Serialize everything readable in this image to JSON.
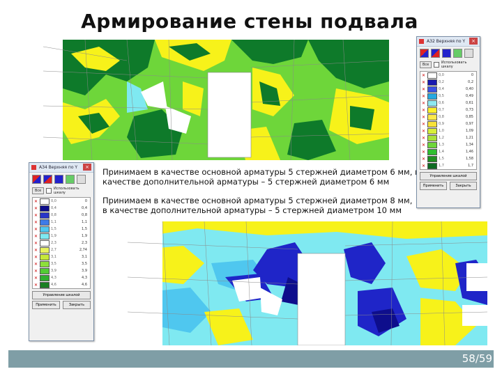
{
  "slide": {
    "title": "Армирование стены подвала",
    "page_current": "58",
    "page_total": "59"
  },
  "captions": {
    "top": "Принимаем в качестве основной арматуры 5 стержней диаметром 6 мм, в качестве дополнительной арматуры – 5 стержней диаметром 6 мм",
    "bottom": "Принимаем в качестве основной арматуры 5 стержней диаметром 8 мм, в качестве дополнительной арматуры – 5 стержней диаметром 10 мм"
  },
  "dialog_right": {
    "title": "АЗ2 Верхняя по Y",
    "button_all": "Все",
    "option_label": "Использовать шкалу",
    "legend": [
      {
        "name": "0,0",
        "color": "#ffffff",
        "value": "0"
      },
      {
        "name": "0,2",
        "color": "#1a1ab0",
        "value": "0,2"
      },
      {
        "name": "0,4",
        "color": "#3c52e6",
        "value": "0,40"
      },
      {
        "name": "0,5",
        "color": "#27a9e1",
        "value": "0,49"
      },
      {
        "name": "0,6",
        "color": "#8ee8f0",
        "value": "0,61"
      },
      {
        "name": "0,7",
        "color": "#fff12a",
        "value": "0,73"
      },
      {
        "name": "0,8",
        "color": "#fde94a",
        "value": "0,85"
      },
      {
        "name": "0,9",
        "color": "#f7e23a",
        "value": "0,97"
      },
      {
        "name": "1,0",
        "color": "#d7ef3a",
        "value": "1,09"
      },
      {
        "name": "1,2",
        "color": "#a9e23a",
        "value": "1,21"
      },
      {
        "name": "1,3",
        "color": "#6ed63a",
        "value": "1,34"
      },
      {
        "name": "1,4",
        "color": "#2fbf2f",
        "value": "1,46"
      },
      {
        "name": "1,5",
        "color": "#1f8f1f",
        "value": "1,58"
      },
      {
        "name": "1,7",
        "color": "#0e6b22",
        "value": "1,7"
      }
    ],
    "button_wide": "Управление шкалой",
    "button_apply": "Применить",
    "button_close": "Закрыть"
  },
  "dialog_left": {
    "title": "АЗ4 Верхняя по Y",
    "button_all": "Все",
    "option_label": "Использовать шкалу",
    "legend": [
      {
        "name": "0,0",
        "color": "#ffffff",
        "value": "0"
      },
      {
        "name": "0,4",
        "color": "#0e0e8c",
        "value": "0,4"
      },
      {
        "name": "0,8",
        "color": "#2a35c8",
        "value": "0,8"
      },
      {
        "name": "1,1",
        "color": "#3d7be8",
        "value": "1,1"
      },
      {
        "name": "1,5",
        "color": "#4fc7ef",
        "value": "1,5"
      },
      {
        "name": "1,9",
        "color": "#7fe9f1",
        "value": "1,9"
      },
      {
        "name": "2,3",
        "color": "#ffffff",
        "value": "2,3"
      },
      {
        "name": "2,7",
        "color": "#e8f260",
        "value": "2,74"
      },
      {
        "name": "3,1",
        "color": "#c6e83a",
        "value": "3,1"
      },
      {
        "name": "3,5",
        "color": "#8ddf3a",
        "value": "3,5"
      },
      {
        "name": "3,9",
        "color": "#52cc35",
        "value": "3,9"
      },
      {
        "name": "4,3",
        "color": "#2fb02f",
        "value": "4,3"
      },
      {
        "name": "4,6",
        "color": "#1a7f23",
        "value": "4,6"
      }
    ],
    "button_wide": "Управление шкалой",
    "button_apply": "Применить",
    "button_close": "Закрыть"
  },
  "colors": {
    "bar": "#7f9ea6",
    "green_dark": "#0e7a2a",
    "green": "#33cc33",
    "yellow": "#f7f21a",
    "cyan": "#7fe9f1",
    "blue": "#1f25c8",
    "sky": "#4fc7ef"
  }
}
